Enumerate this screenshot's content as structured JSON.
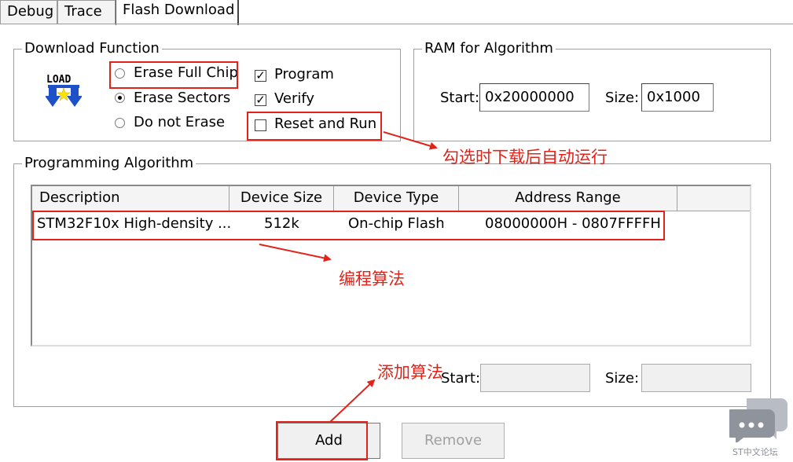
{
  "tabs": [
    "Debug",
    "Trace",
    "Flash Download"
  ],
  "download_function": {
    "title": "Download Function",
    "icon_text": "LOAD",
    "erase_options": [
      {
        "label": "Erase Full Chip",
        "selected": false
      },
      {
        "label": "Erase Sectors",
        "selected": true
      },
      {
        "label": "Do not Erase",
        "selected": false
      }
    ],
    "checks": [
      {
        "label": "Program",
        "checked": true
      },
      {
        "label": "Verify",
        "checked": true
      },
      {
        "label": "Reset and Run",
        "checked": false
      }
    ]
  },
  "ram": {
    "title": "RAM for Algorithm",
    "start_label": "Start:",
    "start_value": "0x20000000",
    "size_label": "Size:",
    "size_value": "0x1000"
  },
  "programming": {
    "title": "Programming Algorithm",
    "columns": [
      "Description",
      "Device Size",
      "Device Type",
      "Address Range"
    ],
    "rows": [
      {
        "description": "STM32F10x High-density ...",
        "size": "512k",
        "type": "On-chip Flash",
        "range": "08000000H - 0807FFFFH"
      }
    ],
    "start_label": "Start:",
    "size_label": "Size:"
  },
  "buttons": {
    "add": "Add",
    "remove": "Remove"
  },
  "annotations": {
    "reset_note": "勾选时下载后自动运行",
    "algo_note": "编程算法",
    "add_note": "添加算法"
  },
  "watermark": "ST中文论坛",
  "colors": {
    "annotation": "#e2231a",
    "icon_blue": "#1e50c8",
    "icon_yellow": "#ffe400"
  }
}
